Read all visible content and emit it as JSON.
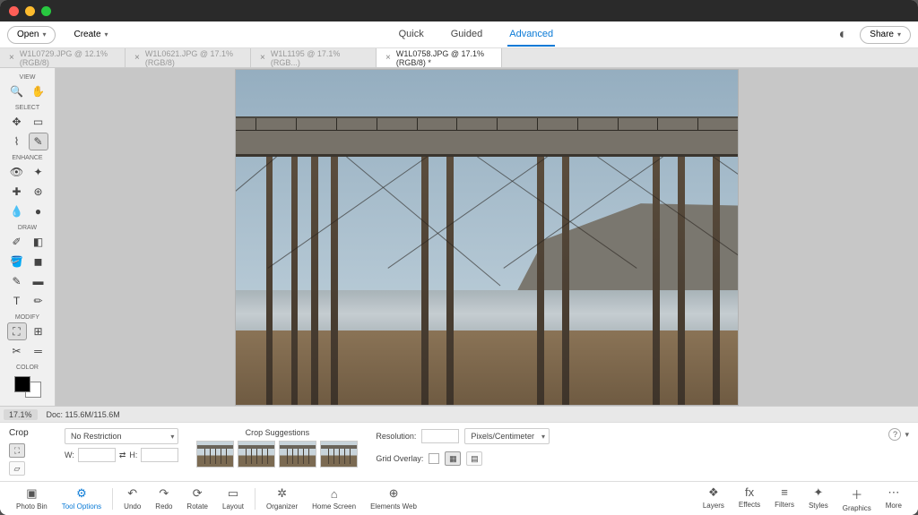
{
  "topbar": {
    "open": "Open",
    "create": "Create",
    "share": "Share"
  },
  "modes": {
    "quick": "Quick",
    "guided": "Guided",
    "advanced": "Advanced"
  },
  "doctabs": [
    {
      "label": "W1L0729.JPG @ 12.1% (RGB/8)",
      "active": false
    },
    {
      "label": "W1L0621.JPG @ 17.1% (RGB/8)",
      "active": false
    },
    {
      "label": "W1L1195 @ 17.1% (RGB...)",
      "active": false
    },
    {
      "label": "W1L0758.JPG @ 17.1% (RGB/8) *",
      "active": true
    }
  ],
  "toolgroups": {
    "view": "VIEW",
    "select": "SELECT",
    "enhance": "ENHANCE",
    "draw": "DRAW",
    "modify": "MODIFY",
    "color": "COLOR"
  },
  "status": {
    "zoom": "17.1%",
    "doc": "Doc: 115.6M/115.6M"
  },
  "options": {
    "crop": "Crop",
    "restrict": "No Restriction",
    "w": "W:",
    "h": "H:",
    "sugg": "Crop Suggestions",
    "res": "Resolution:",
    "units": "Pixels/Centimeter",
    "grid": "Grid Overlay:"
  },
  "bottom": {
    "photobin": "Photo Bin",
    "toolopt": "Tool Options",
    "undo": "Undo",
    "redo": "Redo",
    "rotate": "Rotate",
    "layout": "Layout",
    "organizer": "Organizer",
    "home": "Home Screen",
    "elweb": "Elements Web",
    "layers": "Layers",
    "effects": "Effects",
    "filters": "Filters",
    "styles": "Styles",
    "graphics": "Graphics",
    "more": "More"
  }
}
